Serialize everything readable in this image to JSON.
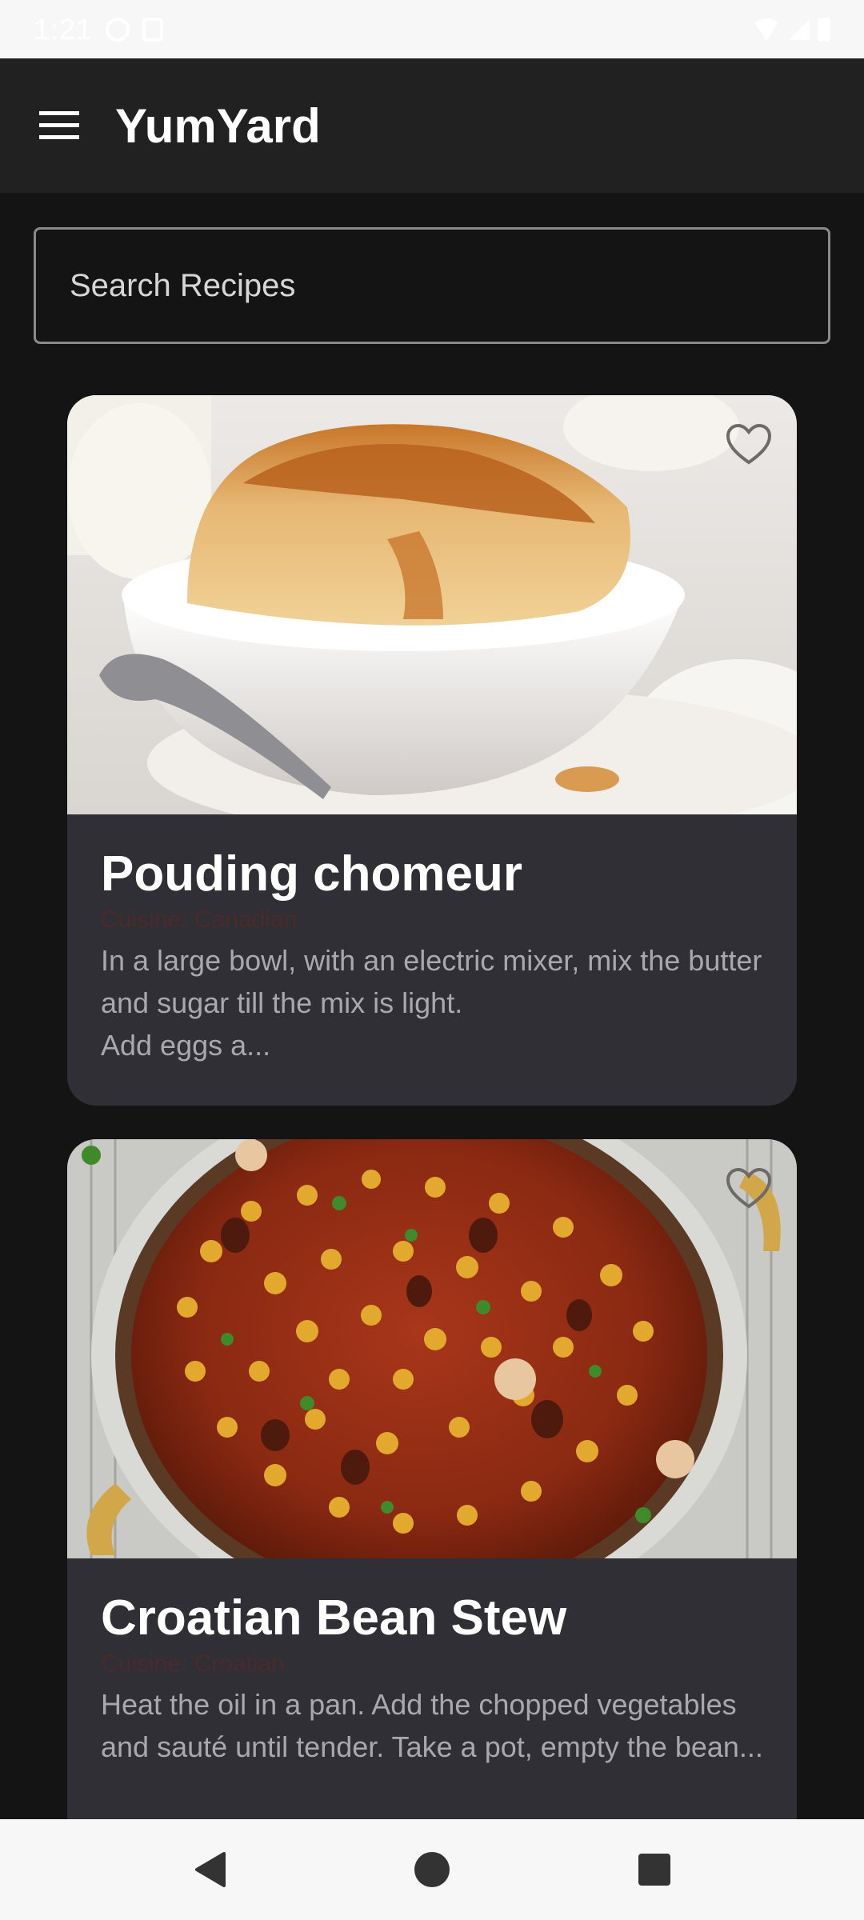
{
  "status_bar": {
    "time": "1:21"
  },
  "app_bar": {
    "title": "YumYard",
    "menu_icon": "hamburger-menu-icon"
  },
  "search": {
    "placeholder": "Search Recipes",
    "value": ""
  },
  "recipes": [
    {
      "title": "Pouding chomeur",
      "cuisine": "Cuisine: Canadian",
      "description": "In a large bowl, with an electric mixer, mix the butter and sugar till the mix is light.\nAdd eggs a...",
      "favorite_icon": "heart-outline-icon",
      "favorited": false
    },
    {
      "title": "Croatian Bean Stew",
      "cuisine": "Cuisine: Croatian",
      "description": "Heat the oil in a pan. Add the chopped vegetables and sauté until tender. Take a pot, empty the bean...",
      "favorite_icon": "heart-outline-icon",
      "favorited": false
    }
  ],
  "nav_bar": {
    "back_icon": "back-triangle-icon",
    "home_icon": "home-circle-icon",
    "recents_icon": "recents-square-icon"
  },
  "colors": {
    "background": "#141414",
    "app_bar": "#212121",
    "card": "#302f35",
    "title_text": "#ffffff",
    "cuisine_text": "#4a2a2a",
    "description_text": "#a9a8ae"
  }
}
